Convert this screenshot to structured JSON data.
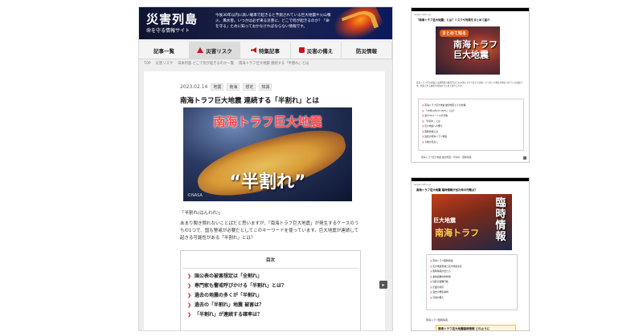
{
  "site": {
    "name": "災害列島",
    "tagline": "命を守る情報サイト",
    "intro": "今後30年以内に高い確率で起きると予測されている巨大地震や火山噴火、風水害。いつかは必ず来る災害に、どこで何が起きるのか？「命を守る」ために知っておかなければならない情報です。"
  },
  "nav": [
    {
      "label": "記事一覧",
      "icon": "none"
    },
    {
      "label": "災害リスク",
      "icon": "warning-icon"
    },
    {
      "label": "特集記事",
      "icon": "megaphone-icon"
    },
    {
      "label": "災害の備え",
      "icon": "bag-icon"
    },
    {
      "label": "防災情報",
      "icon": "none"
    }
  ],
  "breadcrumbs": [
    "TOP",
    "災害リスク",
    "日本列島 どこで何が起きるのか一覧",
    "南海トラフ巨大地震 連続する「半割れ」とは"
  ],
  "article": {
    "date": "2023.02.14",
    "tags": [
      "地震",
      "南海",
      "想定",
      "知識"
    ],
    "title": "南海トラフ巨大地震 連続する「半割れ」とは",
    "hero_title": "南海トラフ巨大地震",
    "hero_big": "“半割れ”",
    "hero_credit": "©NASA",
    "caption": "「半割れ(はんわれ)」",
    "body": "あまり聞き慣れないことばだと思いますが、「南海トラフ巨大地震」が発生するケースのうちの1つで、国も警戒が必要だとしてこのキーワードを使っています。巨大地震が連続して起きる可能性がある「半割れ」とは？",
    "toc_heading": "目次",
    "toc": [
      "国公表の被害想定は「全割れ」",
      "専門家も警戒呼びかける「半割れ」とは？",
      "過去の地震の多くが「半割れ」",
      "過去の「半割れ」地震 被害は？",
      "「半割れ」が連続する確率は？"
    ]
  },
  "thumb1": {
    "url": "saigai-rettou.jp",
    "title": "「南海トラフ巨大地震」とは？リスクや対策をまとめて紹介",
    "img_tag": "まとめて知る",
    "img_big": "南海トラフ 巨大地震",
    "text": "南海トラフ巨大地震とは静岡県の駿河湾から九州沖にかけて延びる南海トラフ沿いで発生が懸念されている地震です。想定される被害や対策をまとめて紹介します。",
    "toc": [
      "南海トラフ巨大地震 被害想定とその対策",
      "「30年以内70〜80%」とは？",
      "最大34メートルの津波",
      "「半割れ」とは",
      "巨大地震への備え",
      "臨時情報とは",
      "過去の南海トラフ地震",
      "今後の見直し"
    ],
    "footer": "南海トラフ巨大地震 被害想定／半割れ／臨時情報"
  },
  "thumb2": {
    "url": "saigai-rettou.jp",
    "title": "南海トラフ巨大地震 臨時情報が出た時の行動は？",
    "img_big": "巨大地震",
    "img_big2": "南海トラフ",
    "img_vert": "臨時情報",
    "toc": [
      "南海トラフ臨時情報",
      "巨大地震警戒と巨大地震注意",
      "臨時情報が出たら",
      "事前避難対象地域",
      "住民の避難行動",
      "企業の対応",
      "過去の発表事例",
      "日頃の備え"
    ],
    "sub": "南海トラフ臨時情報",
    "box": "南海トラフ巨大地震臨時情報 どのように"
  }
}
